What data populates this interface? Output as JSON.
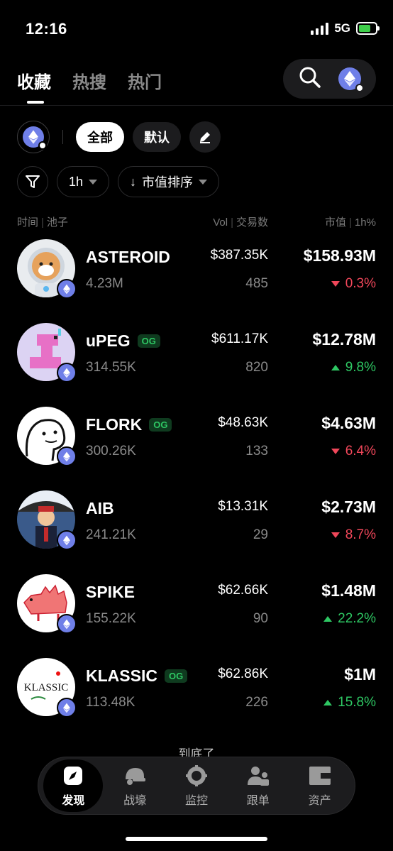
{
  "status_bar": {
    "time": "12:16",
    "network": "5G"
  },
  "tabs": [
    {
      "label": "收藏",
      "active": true
    },
    {
      "label": "热搜",
      "active": false
    },
    {
      "label": "热门",
      "active": false
    }
  ],
  "filters": {
    "all_label": "全部",
    "default_label": "默认",
    "timeframe": "1h",
    "sort_label": "市值排序",
    "sort_arrow": "↓"
  },
  "columns": {
    "time": "时间",
    "pool": "池子",
    "vol": "Vol",
    "tx": "交易数",
    "mcap": "市值",
    "change": "1h%"
  },
  "tokens": [
    {
      "name": "ASTEROID",
      "og": false,
      "sub": "4.23M",
      "vol": "$387.35K",
      "tx": "485",
      "mcap": "$158.93M",
      "change": "0.3%",
      "direction": "down"
    },
    {
      "name": "uPEG",
      "og": true,
      "og_label": "OG",
      "sub": "314.55K",
      "vol": "$611.17K",
      "tx": "820",
      "mcap": "$12.78M",
      "change": "9.8%",
      "direction": "up"
    },
    {
      "name": "FLORK",
      "og": true,
      "og_label": "OG",
      "sub": "300.26K",
      "vol": "$48.63K",
      "tx": "133",
      "mcap": "$4.63M",
      "change": "6.4%",
      "direction": "down"
    },
    {
      "name": "AIB",
      "og": false,
      "sub": "241.21K",
      "vol": "$13.31K",
      "tx": "29",
      "mcap": "$2.73M",
      "change": "8.7%",
      "direction": "down"
    },
    {
      "name": "SPIKE",
      "og": false,
      "sub": "155.22K",
      "vol": "$62.66K",
      "tx": "90",
      "mcap": "$1.48M",
      "change": "22.2%",
      "direction": "up"
    },
    {
      "name": "KLASSIC",
      "og": true,
      "og_label": "OG",
      "sub": "113.48K",
      "vol": "$62.86K",
      "tx": "226",
      "mcap": "$1M",
      "change": "15.8%",
      "direction": "up"
    }
  ],
  "avatar_text": {
    "klassic": "KLASSIC"
  },
  "end_note": "到底了",
  "bottom_nav": [
    {
      "label": "发现",
      "icon": "compass-icon",
      "active": true
    },
    {
      "label": "战壕",
      "icon": "helmet-icon",
      "active": false
    },
    {
      "label": "监控",
      "icon": "monitor-icon",
      "active": false
    },
    {
      "label": "跟单",
      "icon": "copytrade-icon",
      "active": false
    },
    {
      "label": "资产",
      "icon": "wallet-icon",
      "active": false
    }
  ],
  "colors": {
    "up": "#2ec763",
    "down": "#f0475a",
    "eth": "#6f7fe8",
    "og_bg": "#0f3b1f"
  }
}
